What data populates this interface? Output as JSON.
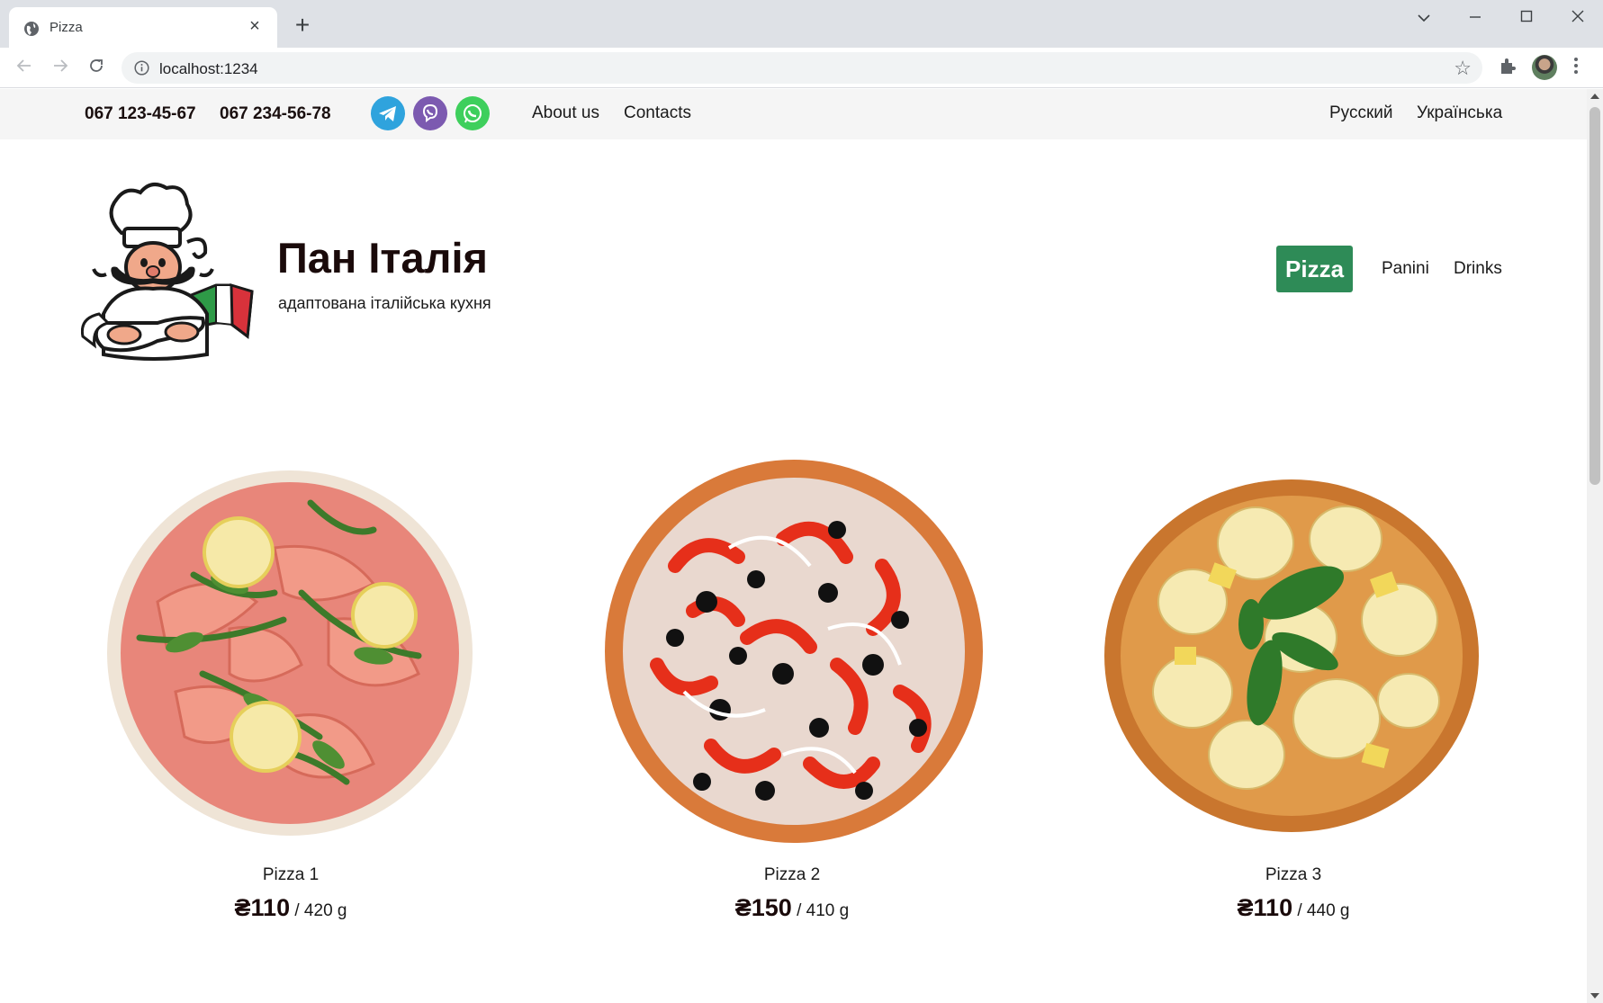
{
  "browser": {
    "tab_title": "Pizza",
    "url": "localhost:1234"
  },
  "topbar": {
    "phones": [
      "067 123-45-67",
      "067 234-56-78"
    ],
    "social": [
      {
        "name": "telegram",
        "color": "#2fa3dd"
      },
      {
        "name": "viber",
        "color": "#7c5ab0"
      },
      {
        "name": "whatsapp",
        "color": "#3ecf5c"
      }
    ],
    "links": [
      "About us",
      "Contacts"
    ],
    "languages": [
      "Русский",
      "Українська"
    ]
  },
  "brand": {
    "title": "Пан Італія",
    "subtitle": "адаптована італійська кухня",
    "logo_icon": "chef-mascot-icon"
  },
  "categories": {
    "items": [
      "Pizza",
      "Panini",
      "Drinks"
    ],
    "active": "Pizza",
    "active_color": "#2e8b57"
  },
  "products": [
    {
      "name": "Pizza 1",
      "price": "₴110",
      "weight": " / 420 g",
      "image_icon": "salmon-pizza-image"
    },
    {
      "name": "Pizza 2",
      "price": "₴150",
      "weight": " / 410 g",
      "image_icon": "pepper-olive-pizza-image"
    },
    {
      "name": "Pizza 3",
      "price": "₴110",
      "weight": " / 440 g",
      "image_icon": "pineapple-basil-pizza-image"
    }
  ]
}
